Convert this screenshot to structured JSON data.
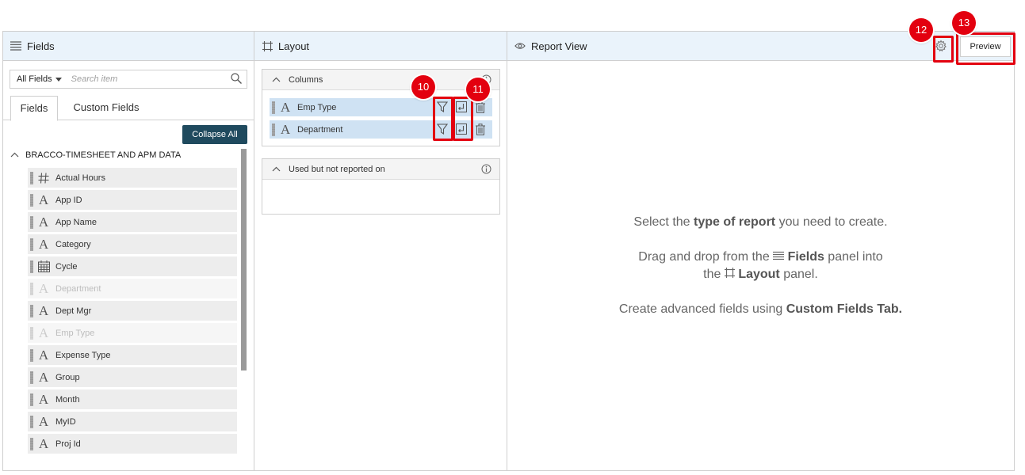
{
  "fields_panel": {
    "title": "Fields",
    "filter_label": "All Fields",
    "search_placeholder": "Search item",
    "tabs": [
      "Fields",
      "Custom Fields"
    ],
    "collapse_label": "Collapse All",
    "group_name": "BRACCO-TIMESHEET AND APM DATA",
    "items": [
      {
        "label": "Actual Hours",
        "type": "number",
        "disabled": false
      },
      {
        "label": "App ID",
        "type": "text",
        "disabled": false
      },
      {
        "label": "App Name",
        "type": "text",
        "disabled": false
      },
      {
        "label": "Category",
        "type": "text",
        "disabled": false
      },
      {
        "label": "Cycle",
        "type": "date",
        "disabled": false
      },
      {
        "label": "Department",
        "type": "text",
        "disabled": true
      },
      {
        "label": "Dept Mgr",
        "type": "text",
        "disabled": false
      },
      {
        "label": "Emp Type",
        "type": "text",
        "disabled": true
      },
      {
        "label": "Expense Type",
        "type": "text",
        "disabled": false
      },
      {
        "label": "Group",
        "type": "text",
        "disabled": false
      },
      {
        "label": "Month",
        "type": "text",
        "disabled": false
      },
      {
        "label": "MyID",
        "type": "text",
        "disabled": false
      },
      {
        "label": "Proj Id",
        "type": "text",
        "disabled": false
      }
    ]
  },
  "layout_panel": {
    "title": "Layout",
    "columns_label": "Columns",
    "columns": [
      "Emp Type",
      "Department"
    ],
    "unreported_label": "Used but not reported on"
  },
  "report_panel": {
    "title": "Report View",
    "preview_label": "Preview",
    "msg1_a": "Select the ",
    "msg1_b": "type of report",
    "msg1_c": " you need to create.",
    "msg2_a": "Drag and drop from the ",
    "msg2_b": "Fields",
    "msg2_c": " panel into",
    "msg3_a": "the ",
    "msg3_b": "Layout",
    "msg3_c": " panel.",
    "msg4_a": "Create advanced fields using ",
    "msg4_b": "Custom Fields Tab."
  },
  "annotations": [
    "10",
    "11",
    "12",
    "13"
  ],
  "colors": {
    "annotation": "#e3000f",
    "header_bg": "#eaf3fb",
    "column_bg": "#cfe2f3",
    "button_dark": "#1f4a5e"
  }
}
